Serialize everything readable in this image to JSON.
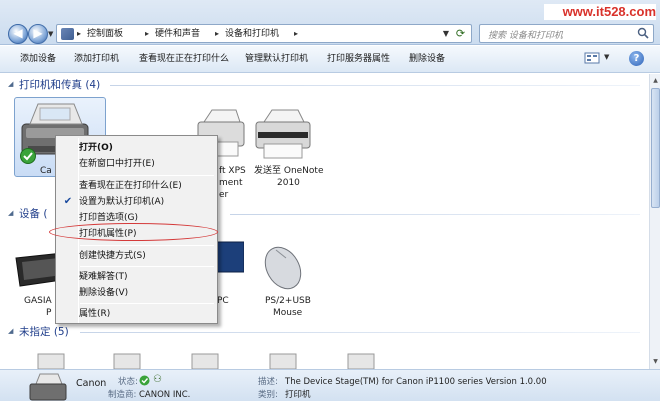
{
  "watermark": "www.it528.com",
  "address_bar": {
    "breadcrumbs": [
      "控制面板",
      "硬件和声音",
      "设备和打印机"
    ],
    "search_placeholder": "搜索 设备和打印机"
  },
  "toolbar": {
    "buttons": [
      "添加设备",
      "添加打印机",
      "查看现在正在打印什么",
      "管理默认打印机",
      "打印服务器属性",
      "删除设备"
    ]
  },
  "groups": {
    "printers": {
      "title": "打印机和传真 (4)"
    },
    "devices": {
      "title": "设备 ("
    },
    "unspecified": {
      "title": "未指定 (5)"
    }
  },
  "printer_items": [
    {
      "label_line1": "Ca"
    },
    {
      "label_line1": "ft XPS",
      "label_line2": "ment",
      "label_line3": "er"
    },
    {
      "label_line1": "发送至 OneNote",
      "label_line2": "2010"
    }
  ],
  "device_items": [
    {
      "label_line1": "GASIA",
      "label_line2": "P"
    },
    {
      "label_line1": "PC"
    },
    {
      "label_line1": "PS/2+USB",
      "label_line2": "Mouse"
    }
  ],
  "context_menu": {
    "items": [
      {
        "label": "打开(O)",
        "bold": true
      },
      {
        "label": "在新窗口中打开(E)"
      },
      {
        "label": "查看现在正在打印什么(E)"
      },
      {
        "label": "设置为默认打印机(A)",
        "checked": true
      },
      {
        "label": "打印首选项(G)"
      },
      {
        "label": "打印机属性(P)",
        "highlighted": true
      },
      {
        "label": "创建快捷方式(S)"
      },
      {
        "label": "疑难解答(T)"
      },
      {
        "label": "删除设备(V)"
      },
      {
        "label": "属性(R)"
      }
    ]
  },
  "details": {
    "name": "Canon",
    "status_label": "状态:",
    "manufacturer_label": "制造商:",
    "manufacturer_value": "CANON INC.",
    "description_label": "描述:",
    "description_value": "The Device Stage(TM) for Canon iP1100 series Version 1.0.00",
    "category_label": "类别:",
    "category_value": "打印机"
  },
  "colors": {
    "annotation_ellipse": "#d43a3a",
    "group_title": "#1f3d8a"
  }
}
